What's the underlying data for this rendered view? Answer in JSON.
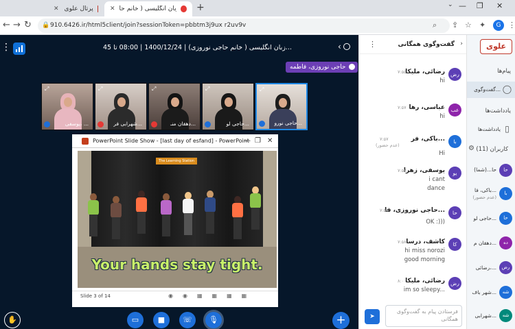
{
  "browser": {
    "tabs": [
      {
        "label": "پرتال علوی",
        "active": false
      },
      {
        "label": "علوی - زبان انگلیسی ( خانم حا...",
        "active": true
      }
    ],
    "url": "910.6426.ir/html5client/join?sessionToken=pbbtm3j9ux r2uv9v",
    "profile_initial": "G"
  },
  "meeting": {
    "title": "زبان انگلیسی ( خانم حاجی نوروزی) | 1400/12/24 | 08:00 تا 45...",
    "talking_indicator": "حاجی نوروزی، فاطمه"
  },
  "webcams": [
    {
      "label": "یوسفی، ..."
    },
    {
      "label": "شهرابی فر..."
    },
    {
      "label": "دهقان منـ..."
    },
    {
      "label": "حاجی لو..."
    },
    {
      "label": "حاجی نورو..."
    }
  ],
  "presentation": {
    "window_title": "PowerPoint Slide Show - [last day of esfand] - PowerPoint",
    "banner": "The Learning Station",
    "caption": "Your hands stay tight.",
    "slide_number": "Slide 3 of 14"
  },
  "chat": {
    "title": "گفت‌وگوی همگانی",
    "input_placeholder": "فرستادن پیام به گفت‌وگوی همگانی",
    "messages": [
      {
        "initials": "رض",
        "color": "#5c3fb5",
        "name": "رضائی، ملیکا",
        "time": "۷:۵۵",
        "lines": [
          "hi"
        ]
      },
      {
        "initials": "عب",
        "color": "#8e24aa",
        "name": "عباسی، رها",
        "time": "۷:۵۷",
        "lines": [
          "hi"
        ]
      },
      {
        "initials": "با",
        "color": "#1e6fd9",
        "name": "باکی، فر...",
        "time": "۷:۵۷",
        "note": "(عدم حضور)",
        "lines": [
          "Hi"
        ]
      },
      {
        "initials": "یو",
        "color": "#5c3fb5",
        "name": "یوسفی، زهرا",
        "time": "۷:۵۷",
        "lines": [
          "i cant",
          "dance"
        ]
      },
      {
        "initials": "حا",
        "color": "#5c3fb5",
        "name": "حاجی نوروزی، فا...",
        "time": "۷:۵۸",
        "lines": [
          "OK :)))"
        ]
      },
      {
        "initials": "کا",
        "color": "#5c3fb5",
        "name": "کاشف، درسا",
        "time": "۷:۵۸",
        "lines": [
          "hi miss norozi",
          "good morning"
        ]
      },
      {
        "initials": "رض",
        "color": "#5c3fb5",
        "name": "رضائی، ملیکا",
        "time": "۸:۰۰",
        "lines": [
          "im so sleepy..."
        ]
      }
    ]
  },
  "sidebar": {
    "brand": "علوی",
    "sections": {
      "messages": "پیام‌ها",
      "notes": "یادداشت‌ها",
      "users": "کاربران (11)"
    },
    "items": {
      "public_chat": "گفت‌وگوی...",
      "shared_notes": "یادداشت‌ها"
    },
    "users": [
      {
        "initials": "حا",
        "color": "#5c3fb5",
        "name": "حا...(شما)",
        "sub": ""
      },
      {
        "initials": "با",
        "color": "#1e6fd9",
        "name": "باکی، فا...",
        "sub": "(عدم حضور)"
      },
      {
        "initials": "حا",
        "color": "#1e6fd9",
        "name": "حاجی لو...",
        "sub": ""
      },
      {
        "initials": "ده",
        "color": "#8e24aa",
        "name": "دهقان م...",
        "sub": ""
      },
      {
        "initials": "رض",
        "color": "#5c3fb5",
        "name": "رضائی،...",
        "sub": ""
      },
      {
        "initials": "شه",
        "color": "#1e6fd9",
        "name": "شهر باف...",
        "sub": ""
      },
      {
        "initials": "شه",
        "color": "#00897b",
        "name": "شهرابی...",
        "sub": ""
      }
    ]
  }
}
